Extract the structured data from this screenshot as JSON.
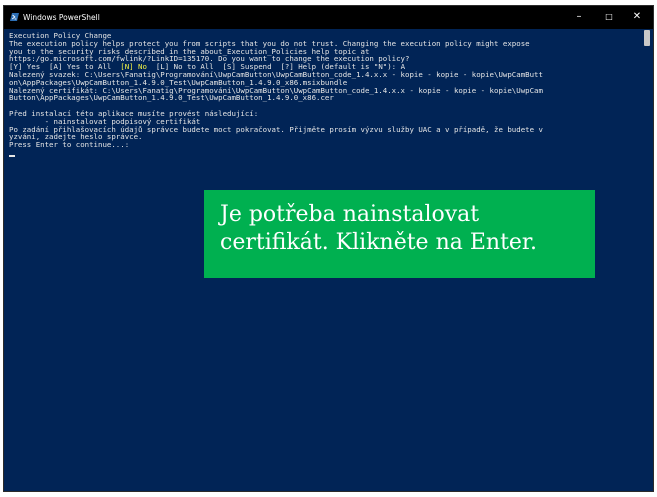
{
  "window": {
    "title": "Windows PowerShell",
    "controls": {
      "minimize": "–",
      "maximize": "□",
      "close": "✕"
    },
    "icon": "powershell-icon"
  },
  "console": {
    "lines": [
      {
        "t": "Execution Policy Change"
      },
      {
        "t": "The execution policy helps protect you from scripts that you do not trust. Changing the execution policy might expose"
      },
      {
        "t": "you to the security risks described in the about_Execution_Policies help topic at"
      },
      {
        "t": "https:/go.microsoft.com/fwlink/?LinkID=135170. Do you want to change the execution policy?"
      },
      {
        "segs": [
          {
            "t": "[Y] Yes  [A] Yes to All  "
          },
          {
            "t": "[N] No",
            "c": "yellow"
          },
          {
            "t": "  [L] No to All  [S] Suspend  [?] Help (default is \"N\"): A"
          }
        ]
      },
      {
        "t": "Nalezený svazek: C:\\Users\\Fanatig\\Programování\\UwpCamButton\\UwpCamButton_code_1.4.x.x - kopie - kopie - kopie\\UwpCamButt"
      },
      {
        "t": "on\\AppPackages\\UwpCamButton_1.4.9.0_Test\\UwpCamButton_1.4.9.0_x86.msixbundle"
      },
      {
        "t": "Nalezený certifikát: C:\\Users\\Fanatig\\Programování\\UwpCamButton\\UwpCamButton_code_1.4.x.x - kopie - kopie - kopie\\UwpCam"
      },
      {
        "t": "Button\\AppPackages\\UwpCamButton_1.4.9.0_Test\\UwpCamButton_1.4.9.0_x86.cer"
      },
      {
        "t": ""
      },
      {
        "t": "Před instalací této aplikace musíte provést následující:"
      },
      {
        "t": "        - nainstalovat podpisový certifikát"
      },
      {
        "t": "Po zadání přihlašovacích údajů správce budete moct pokračovat. Přijměte prosím výzvu služby UAC a v případě, že budete v"
      },
      {
        "t": "yzváni, zadejte heslo správce."
      },
      {
        "t": "Press Enter to continue...:"
      }
    ],
    "colors": {
      "background": "#012456",
      "text": "#e6e6e6",
      "highlight": "#f5f543"
    }
  },
  "callout": {
    "lines": [
      "Je potřeba nainstalovat",
      "certifikát. Klikněte na Enter."
    ],
    "color": "#00b050"
  }
}
